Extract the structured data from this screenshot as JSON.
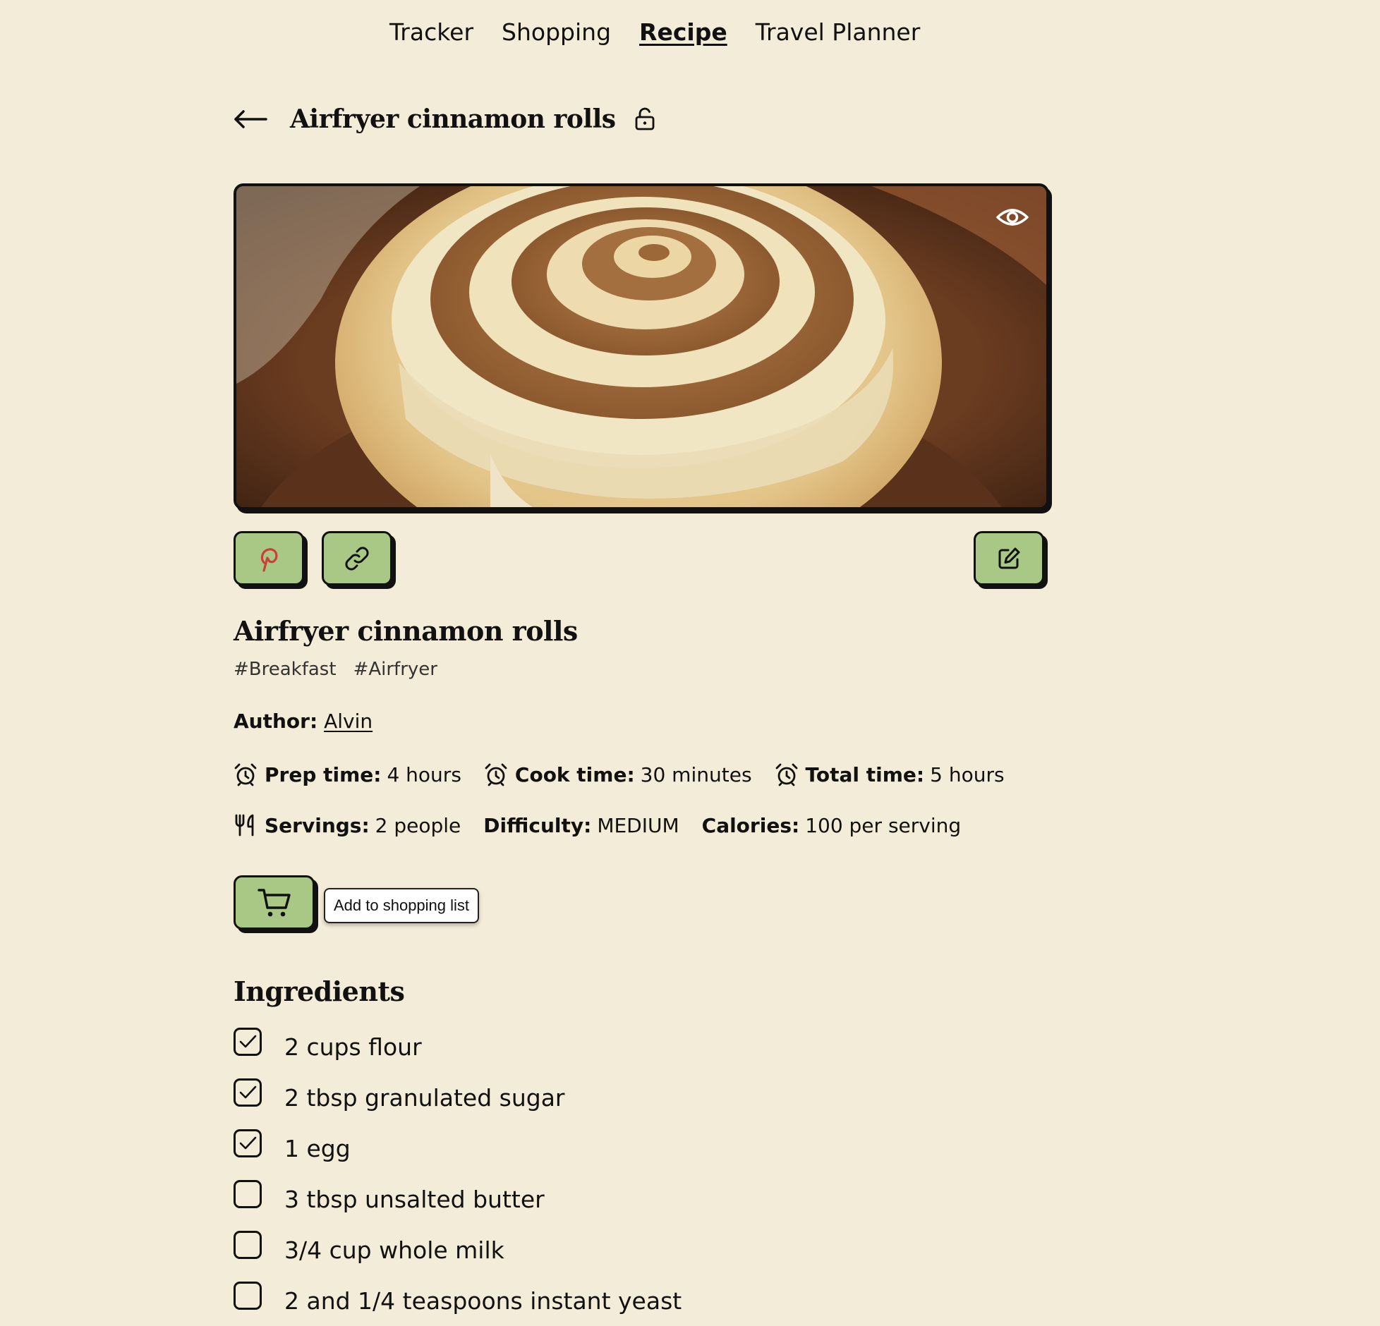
{
  "nav": {
    "items": [
      {
        "label": "Tracker"
      },
      {
        "label": "Shopping"
      },
      {
        "label": "Recipe"
      },
      {
        "label": "Travel Planner"
      }
    ],
    "active": "Recipe"
  },
  "header": {
    "title": "Airfryer cinnamon rolls"
  },
  "recipe": {
    "title": "Airfryer cinnamon rolls",
    "tags": [
      "#Breakfast",
      "#Airfryer"
    ],
    "author_label": "Author:",
    "author_name": "Alvin",
    "prep_label": "Prep time:",
    "prep_value": "4 hours",
    "cook_label": "Cook time:",
    "cook_value": "30 minutes",
    "total_label": "Total time:",
    "total_value": "5 hours",
    "servings_label": "Servings:",
    "servings_value": "2 people",
    "difficulty_label": "Difficulty:",
    "difficulty_value": "MEDIUM",
    "calories_label": "Calories:",
    "calories_value": "100 per serving"
  },
  "shopping": {
    "tooltip": "Add to shopping list"
  },
  "ingredients": {
    "heading": "Ingredients",
    "items": [
      {
        "label": "2 cups flour",
        "checked": true
      },
      {
        "label": "2 tbsp granulated sugar",
        "checked": true
      },
      {
        "label": "1 egg",
        "checked": true
      },
      {
        "label": "3 tbsp unsalted butter",
        "checked": false
      },
      {
        "label": "3/4 cup whole milk",
        "checked": false
      },
      {
        "label": "2 and 1/4 teaspoons instant yeast",
        "checked": false
      }
    ]
  },
  "colors": {
    "background": "#f3ecd8",
    "button_green": "#a9c785",
    "pinterest_red": "#c8403c",
    "border": "#111111"
  },
  "icons": {
    "back": "arrow-left-icon",
    "lock": "unlock-icon",
    "eye": "eye-icon",
    "pinterest": "pinterest-icon",
    "link": "link-icon",
    "edit": "edit-icon",
    "alarm": "alarm-clock-icon",
    "utensils": "utensils-icon",
    "cart": "cart-icon",
    "check": "check-icon"
  }
}
